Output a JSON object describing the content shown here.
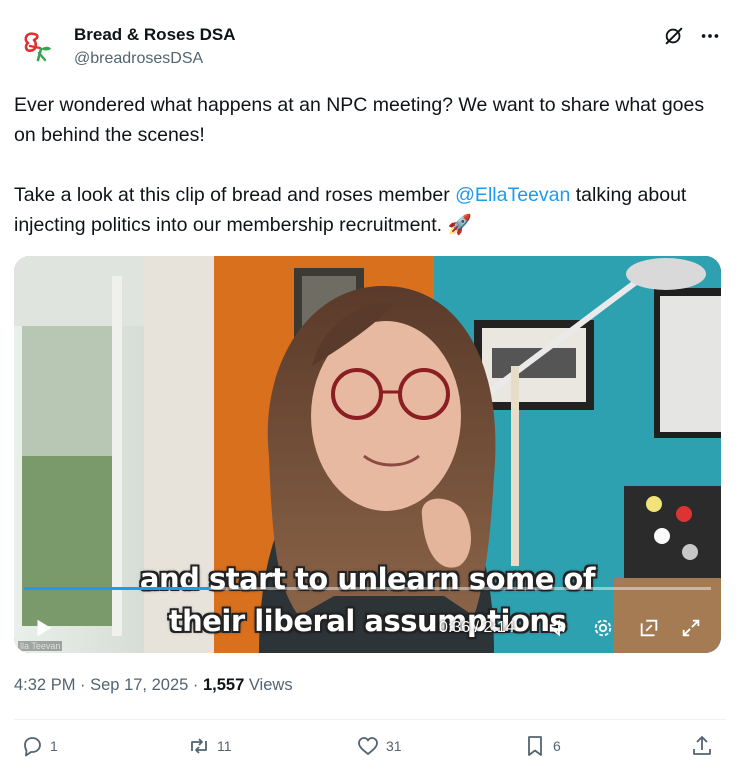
{
  "author": {
    "name": "Bread & Roses DSA",
    "handle": "@breadrosesDSA",
    "avatar_icon": "rose-logo-icon"
  },
  "header_icons": [
    "grok-icon",
    "more-icon"
  ],
  "tweet": {
    "line1": "Ever wondered what happens at an NPC meeting? We want to share what goes on behind the scenes!",
    "line2_prefix": "Take a look at this clip of bread and roses member ",
    "mention": "@EllaTeevan",
    "line2_suffix": " talking about injecting politics into our membership recruitment. ",
    "emoji": "🚀"
  },
  "video": {
    "caption_line1": "and start to unlearn some of",
    "caption_line2": "their liberal assumptions",
    "current_time": "0:36",
    "duration": "2:14",
    "time_display": "0:36 / 2:14",
    "progress": 0.27,
    "watermark": "lla Teevan"
  },
  "meta": {
    "time": "4:32 PM",
    "sep": " · ",
    "date": "Sep 17, 2025",
    "views_count": "1,557",
    "views_label": " Views"
  },
  "actions": {
    "replies": "1",
    "reposts": "11",
    "likes": "31",
    "bookmarks": "6"
  },
  "colors": {
    "accent": "#1d9bf0",
    "text": "#0f1419",
    "secondary": "#536471"
  }
}
